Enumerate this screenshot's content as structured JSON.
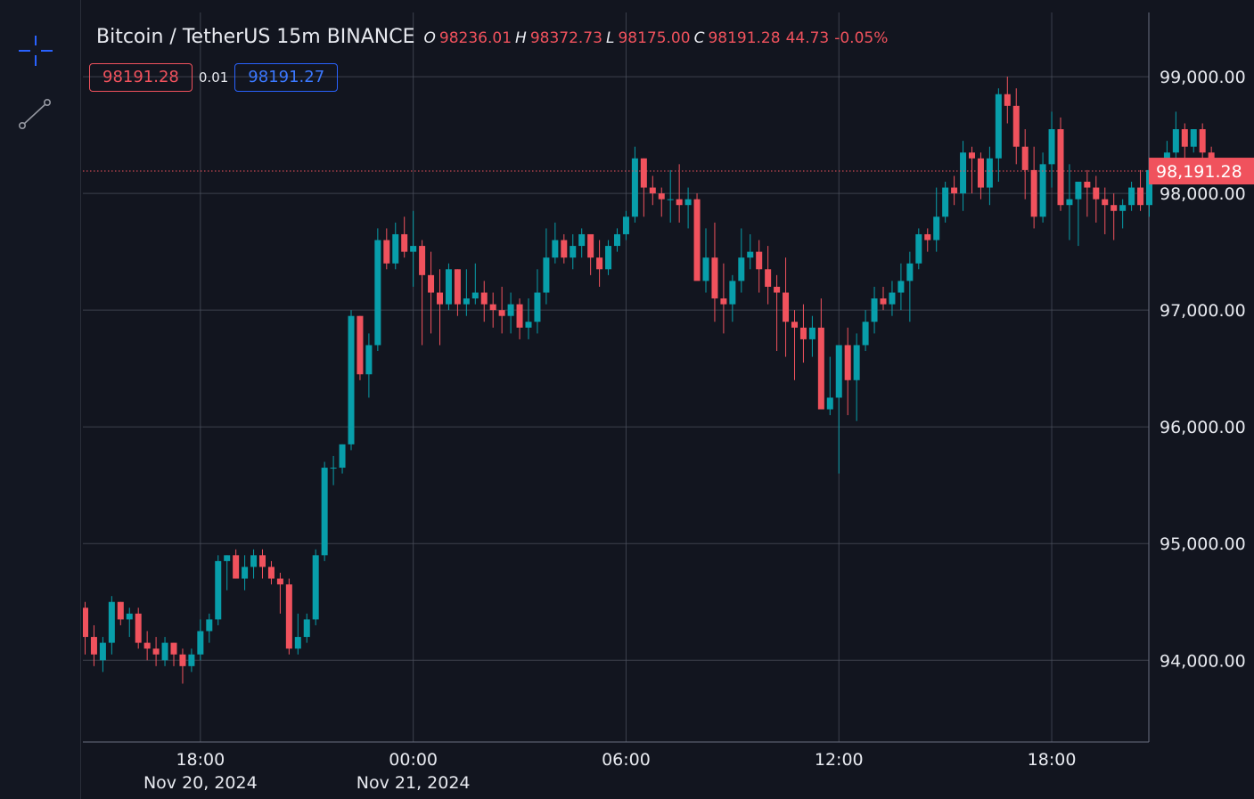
{
  "header": {
    "symbol_title": "Bitcoin / TetherUS 15m BINANCE",
    "open_key": "O",
    "open": "98236.01",
    "high_key": "H",
    "high": "98372.73",
    "low_key": "L",
    "low": "98175.00",
    "close_key": "C",
    "close": "98191.28",
    "change": "44.73",
    "change_pct": "-0.05%"
  },
  "trade": {
    "sell_price": "98191.28",
    "spread": "0.01",
    "buy_price": "98191.27"
  },
  "toolbar": {
    "items": [
      {
        "icon": "crosshair-icon"
      },
      {
        "icon": "trend-line-icon"
      }
    ]
  },
  "colors": {
    "background": "#12151f",
    "up": "#089eaa",
    "down": "#f0525d",
    "grid": "#4a4f5c",
    "accent": "#2962ff"
  },
  "chart_data": {
    "type": "candlestick",
    "title": "Bitcoin / TetherUS 15m BINANCE",
    "ylim": [
      93300,
      99550
    ],
    "y_ticks": [
      {
        "value": 94000,
        "label": "94,000.00"
      },
      {
        "value": 95000,
        "label": "95,000.00"
      },
      {
        "value": 96000,
        "label": "96,000.00"
      },
      {
        "value": 97000,
        "label": "97,000.00"
      },
      {
        "value": 98000,
        "label": "98,000.00"
      },
      {
        "value": 99000,
        "label": "99,000.00"
      }
    ],
    "x_ticks": [
      {
        "index": 13,
        "label": "18:00",
        "sublabel": "Nov 20, 2024"
      },
      {
        "index": 37,
        "label": "00:00",
        "sublabel": "Nov 21, 2024"
      },
      {
        "index": 61,
        "label": "06:00",
        "sublabel": ""
      },
      {
        "index": 85,
        "label": "12:00",
        "sublabel": ""
      },
      {
        "index": 109,
        "label": "18:00",
        "sublabel": ""
      }
    ],
    "last_price": {
      "value": 98191.28,
      "label": "98,191.28"
    },
    "candles": [
      [
        94450,
        94500,
        94050,
        94200
      ],
      [
        94200,
        94300,
        93950,
        94050
      ],
      [
        94000,
        94200,
        93900,
        94150
      ],
      [
        94150,
        94550,
        94050,
        94500
      ],
      [
        94500,
        94500,
        94300,
        94350
      ],
      [
        94350,
        94450,
        94200,
        94400
      ],
      [
        94400,
        94450,
        94100,
        94150
      ],
      [
        94150,
        94250,
        94000,
        94100
      ],
      [
        94100,
        94200,
        93950,
        94050
      ],
      [
        94000,
        94200,
        93950,
        94150
      ],
      [
        94150,
        94150,
        93950,
        94050
      ],
      [
        94050,
        94100,
        93800,
        93950
      ],
      [
        93950,
        94100,
        93900,
        94050
      ],
      [
        94050,
        94350,
        94000,
        94250
      ],
      [
        94250,
        94400,
        94150,
        94350
      ],
      [
        94350,
        94900,
        94300,
        94850
      ],
      [
        94850,
        94900,
        94600,
        94900
      ],
      [
        94900,
        94950,
        94700,
        94700
      ],
      [
        94700,
        94900,
        94600,
        94800
      ],
      [
        94800,
        94950,
        94700,
        94900
      ],
      [
        94900,
        94950,
        94700,
        94800
      ],
      [
        94800,
        94850,
        94650,
        94700
      ],
      [
        94700,
        94750,
        94400,
        94650
      ],
      [
        94650,
        94700,
        94050,
        94100
      ],
      [
        94100,
        94400,
        94050,
        94200
      ],
      [
        94200,
        94400,
        94150,
        94350
      ],
      [
        94350,
        94950,
        94300,
        94900
      ],
      [
        94900,
        95700,
        94850,
        95650
      ],
      [
        95650,
        95750,
        95500,
        95650
      ],
      [
        95650,
        95850,
        95600,
        95850
      ],
      [
        95850,
        97000,
        95800,
        96950
      ],
      [
        96950,
        96950,
        96400,
        96450
      ],
      [
        96450,
        96800,
        96250,
        96700
      ],
      [
        96700,
        97700,
        96650,
        97600
      ],
      [
        97600,
        97700,
        97350,
        97400
      ],
      [
        97400,
        97750,
        97350,
        97650
      ],
      [
        97650,
        97800,
        97450,
        97500
      ],
      [
        97500,
        97850,
        97200,
        97550
      ],
      [
        97550,
        97600,
        96700,
        97300
      ],
      [
        97300,
        97500,
        96800,
        97150
      ],
      [
        97150,
        97350,
        96700,
        97050
      ],
      [
        97050,
        97400,
        97000,
        97350
      ],
      [
        97350,
        97350,
        96950,
        97050
      ],
      [
        97050,
        97350,
        96950,
        97100
      ],
      [
        97100,
        97400,
        97050,
        97150
      ],
      [
        97150,
        97250,
        96900,
        97050
      ],
      [
        97050,
        97150,
        96850,
        97000
      ],
      [
        97000,
        97200,
        96800,
        96950
      ],
      [
        96950,
        97150,
        96800,
        97050
      ],
      [
        97050,
        97100,
        96750,
        96850
      ],
      [
        96850,
        97100,
        96750,
        96900
      ],
      [
        96900,
        97350,
        96800,
        97150
      ],
      [
        97150,
        97700,
        97050,
        97450
      ],
      [
        97450,
        97750,
        97400,
        97600
      ],
      [
        97600,
        97650,
        97400,
        97450
      ],
      [
        97450,
        97650,
        97350,
        97550
      ],
      [
        97550,
        97700,
        97450,
        97650
      ],
      [
        97650,
        97650,
        97300,
        97450
      ],
      [
        97450,
        97600,
        97200,
        97350
      ],
      [
        97350,
        97600,
        97300,
        97550
      ],
      [
        97550,
        97700,
        97500,
        97650
      ],
      [
        97650,
        97850,
        97600,
        97800
      ],
      [
        97800,
        98400,
        97750,
        98300
      ],
      [
        98300,
        98300,
        97800,
        98050
      ],
      [
        98050,
        98150,
        97900,
        98000
      ],
      [
        98000,
        98050,
        97800,
        97950
      ],
      [
        97950,
        98200,
        97750,
        97950
      ],
      [
        97950,
        98250,
        97750,
        97900
      ],
      [
        97900,
        98050,
        97700,
        97950
      ],
      [
        97950,
        98000,
        97700,
        97250
      ],
      [
        97250,
        97700,
        97150,
        97450
      ],
      [
        97450,
        97750,
        96900,
        97100
      ],
      [
        97100,
        97400,
        96800,
        97050
      ],
      [
        97050,
        97300,
        96900,
        97250
      ],
      [
        97250,
        97700,
        97150,
        97450
      ],
      [
        97450,
        97650,
        97350,
        97500
      ],
      [
        97500,
        97600,
        97150,
        97350
      ],
      [
        97350,
        97550,
        97050,
        97200
      ],
      [
        97200,
        97300,
        96650,
        97150
      ],
      [
        97150,
        97450,
        96600,
        96900
      ],
      [
        96900,
        97000,
        96400,
        96850
      ],
      [
        96850,
        97050,
        96550,
        96750
      ],
      [
        96750,
        96950,
        96600,
        96850
      ],
      [
        96850,
        97100,
        96150,
        96150
      ],
      [
        96150,
        96600,
        96100,
        96250
      ],
      [
        96250,
        96550,
        95600,
        96700
      ],
      [
        96700,
        96850,
        96100,
        96400
      ],
      [
        96400,
        96800,
        96050,
        96700
      ],
      [
        96700,
        97000,
        96650,
        96900
      ],
      [
        96900,
        97200,
        96800,
        97100
      ],
      [
        97100,
        97200,
        97000,
        97050
      ],
      [
        97050,
        97250,
        96950,
        97150
      ],
      [
        97150,
        97400,
        97000,
        97250
      ],
      [
        97250,
        97500,
        96900,
        97400
      ],
      [
        97400,
        97700,
        97350,
        97650
      ],
      [
        97650,
        97700,
        97500,
        97600
      ],
      [
        97600,
        98050,
        97500,
        97800
      ],
      [
        97800,
        98100,
        97750,
        98050
      ],
      [
        98050,
        98150,
        97900,
        98000
      ],
      [
        98000,
        98450,
        97850,
        98350
      ],
      [
        98350,
        98400,
        98000,
        98300
      ],
      [
        98300,
        98350,
        97950,
        98050
      ],
      [
        98050,
        98400,
        97900,
        98300
      ],
      [
        98300,
        98900,
        98100,
        98850
      ],
      [
        98850,
        99000,
        98600,
        98750
      ],
      [
        98750,
        98900,
        98250,
        98400
      ],
      [
        98400,
        98550,
        97950,
        98200
      ],
      [
        98200,
        98400,
        97700,
        97800
      ],
      [
        97800,
        98350,
        97750,
        98250
      ],
      [
        98250,
        98700,
        98050,
        98550
      ],
      [
        98550,
        98650,
        97850,
        97900
      ],
      [
        97900,
        98250,
        97600,
        97950
      ],
      [
        97950,
        98100,
        97550,
        98100
      ],
      [
        98100,
        98200,
        97800,
        98050
      ],
      [
        98050,
        98150,
        97750,
        97950
      ],
      [
        97950,
        98050,
        97650,
        97900
      ],
      [
        97900,
        98000,
        97600,
        97850
      ],
      [
        97850,
        97950,
        97700,
        97900
      ],
      [
        97900,
        98100,
        97850,
        98050
      ],
      [
        98050,
        98200,
        97850,
        97900
      ],
      [
        97900,
        98150,
        97800,
        98200
      ],
      [
        98200,
        98250,
        98100,
        98250
      ],
      [
        98250,
        98450,
        98150,
        98350
      ],
      [
        98350,
        98700,
        98300,
        98550
      ],
      [
        98550,
        98600,
        98300,
        98400
      ],
      [
        98400,
        98550,
        98350,
        98550
      ],
      [
        98550,
        98600,
        98300,
        98350
      ],
      [
        98350,
        98400,
        98200,
        98250
      ],
      [
        98250,
        98300,
        98100,
        98150
      ],
      [
        98150,
        98250,
        98100,
        98191.28
      ]
    ]
  }
}
